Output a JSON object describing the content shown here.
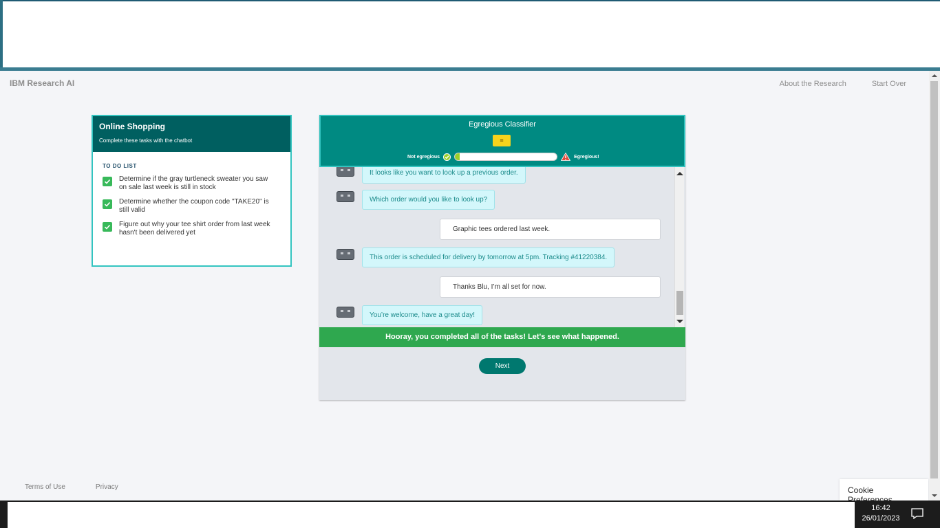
{
  "header": {
    "brand": "IBM Research AI",
    "links": [
      "About the Research",
      "Start Over"
    ]
  },
  "task_card": {
    "title": "Online Shopping",
    "subtitle": "Complete these tasks with the chatbot",
    "todo_label": "TO DO LIST",
    "items": [
      {
        "text": "Determine if the gray turtleneck sweater you saw on sale last week is still in stock",
        "done": true
      },
      {
        "text": "Determine whether the coupon code \"TAKE20\" is still valid",
        "done": true
      },
      {
        "text": "Figure out why your tee shirt order from last week hasn't been delivered yet",
        "done": true
      }
    ]
  },
  "classifier": {
    "title": "Egregious Classifier",
    "left_label": "Not egregious",
    "right_label": "Egregious!",
    "level": 0.05
  },
  "chat": {
    "messages": [
      {
        "from": "bot",
        "text": "It looks like you want to look up a previous order."
      },
      {
        "from": "bot",
        "text": "Which order would you like to look up?"
      },
      {
        "from": "user",
        "text": "Graphic tees ordered last week."
      },
      {
        "from": "bot",
        "text": "This order is scheduled for delivery by tomorrow at 5pm. Tracking #41220384."
      },
      {
        "from": "user",
        "text": "Thanks Blu, I’m all set for now."
      },
      {
        "from": "bot",
        "text": "You’re welcome, have a great day!"
      }
    ],
    "completion_banner": "Hooray, you completed all of the tasks! Let's see what happened.",
    "next_label": "Next"
  },
  "footer": {
    "links": [
      "Terms of Use",
      "Privacy"
    ],
    "cookie_label": "Cookie Preferences"
  },
  "taskbar": {
    "time": "16:42",
    "date": "26/01/2023"
  },
  "colors": {
    "teal_dark": "#005f60",
    "teal": "#008a82",
    "green": "#2fa84f",
    "cyan_border": "#33c4c0"
  }
}
